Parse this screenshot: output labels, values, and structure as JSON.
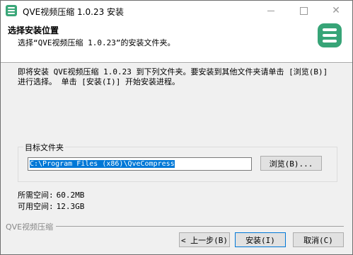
{
  "window": {
    "title": "QVE视频压缩 1.0.23 安装",
    "icon": "app-logo-icon",
    "controls": [
      "minimize-icon",
      "maximize-icon",
      "close-icon"
    ]
  },
  "header": {
    "title": "选择安装位置",
    "subtitle": "选择“QVE视频压缩 1.0.23”的安装文件夹。",
    "logo": "app-logo-icon",
    "logo_color": "#37a477"
  },
  "main": {
    "description": "即将安装 QVE视频压缩 1.0.23 到下列文件夹。要安装到其他文件夹请单击 [浏览(B)] 进行选择。 单击 [安装(I)] 开始安装进程。",
    "target_group_label": "目标文件夹",
    "target_path": "C:\\Program Files (x86)\\QveCompress",
    "browse_label": "浏览(B)...",
    "required_space_label": "所需空间:",
    "required_space_value": "60.2MB",
    "available_space_label": "可用空间:",
    "available_space_value": "12.3GB"
  },
  "footer": {
    "branding": "QVE视频压缩",
    "back_label": "< 上一步(B)",
    "install_label": "安装(I)",
    "cancel_label": "取消(C)"
  },
  "colors": {
    "accent": "#0078d7",
    "brand": "#37a477"
  }
}
